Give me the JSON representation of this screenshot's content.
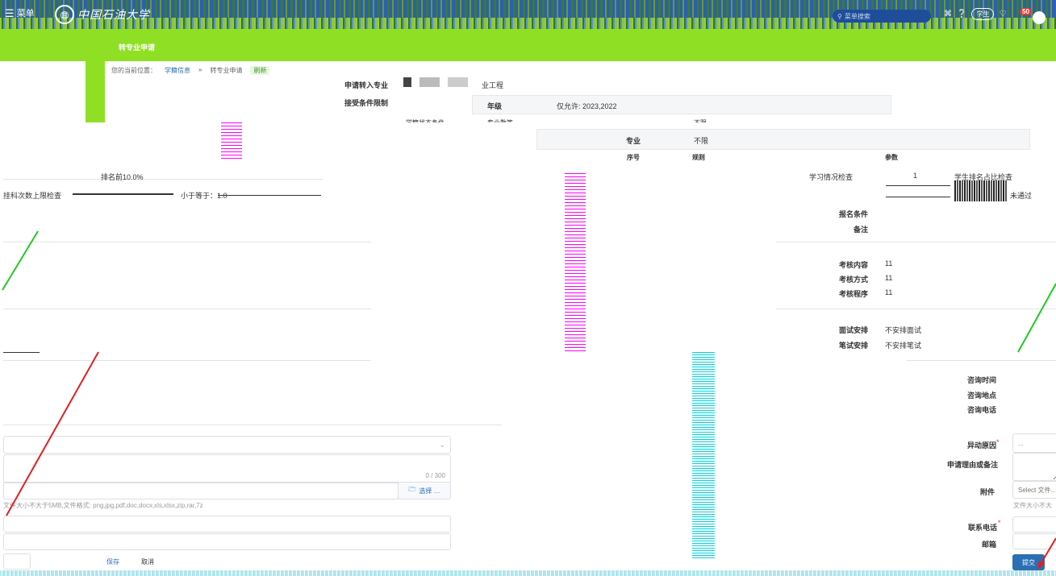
{
  "header": {
    "menu_label": "菜单",
    "school_name": "中国石油大学",
    "search_placeholder": "菜单搜索",
    "role": "学生",
    "notif_count": "50"
  },
  "page": {
    "title": "转专业申请"
  },
  "breadcrumb": {
    "prefix": "您的当前位置：",
    "crumb1": "学籍信息",
    "sep": "»",
    "crumb2": "转专业申请",
    "refresh": "刷新"
  },
  "info": {
    "major_label": "申请转入专业",
    "major_value": "业工程",
    "limit_label": "接受条件限制",
    "grade_label": "年级",
    "grade_value": "仅允许: 2023,2022",
    "cond_label": "学籍状态条件",
    "major_cond": "专业数等",
    "grade_cond": "不限",
    "specialty_label": "专业",
    "specialty_value": "不限",
    "table_headers": [
      "序号",
      "规则",
      "参数"
    ],
    "rank_text": "排名前10.0%",
    "credit_text": "挂科次数上限检查",
    "credit_param": "小于等于：1.0",
    "study_check": "学习情况检查",
    "row_no": "1",
    "rank_check": "学生排名占比检查",
    "result": "未通过"
  },
  "signup": {
    "cond_label": "报名条件",
    "note_label": "备注"
  },
  "exam": {
    "content_label": "考核内容",
    "content_value": "11",
    "method_label": "考核方式",
    "method_value": "11",
    "procedure_label": "考核程序",
    "procedure_value": "11"
  },
  "schedule": {
    "interview_label": "面试安排",
    "interview_value": "不安排面试",
    "written_label": "笔试安排",
    "written_value": "不安排笔试"
  },
  "consult": {
    "time_label": "咨询时间",
    "place_label": "咨询地点",
    "phone_label": "咨询电话"
  },
  "form": {
    "reason_label": "异动原因",
    "reason_placeholder": "...",
    "remark_label": "申请理由或备注",
    "char_count": "0 / 300",
    "attach_label": "附件",
    "attach_placeholder": "Select 文件...",
    "file_hint_right": "文件大小不大",
    "file_hint_left": "文件大小不大于5MB,文件格式: png,jpg,pdf,doc,docx,xls,xlsx,zip,rar,7z",
    "select_button": "选择 …",
    "phone_label": "联系电话",
    "email_label": "邮箱",
    "save_button": "保存",
    "cancel_button": "取消",
    "submit_button": "提交"
  }
}
